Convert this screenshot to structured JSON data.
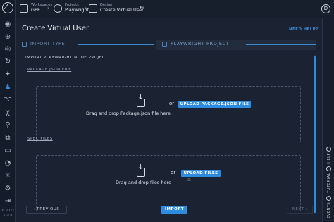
{
  "topbar": {
    "workspace_small": "Workspaces",
    "workspace_name": "GPE",
    "projects_small": "Projects",
    "project_name": "Playwright",
    "design_small": "Design",
    "design_name": "Create Virtual User",
    "back_icon": "arrow-left-icon",
    "avatar_letter": "D"
  },
  "page": {
    "title": "Create Virtual User",
    "help_link": "NEED HELP?"
  },
  "steps": [
    {
      "label": "IMPORT TYPE",
      "state": "done"
    },
    {
      "label": "PLAYWRIGHT PROJECT",
      "state": "current"
    }
  ],
  "import": {
    "section_title": "IMPORT PLAYWRIGHT NODE PROJECT",
    "package_label": "PACKAGE.JSON FILE",
    "package_drop_text": "Drag and drop Package.json file here",
    "package_or": "or",
    "package_button": "UPLOAD PACKAGE.JSON FILE",
    "spec_label": "SPEC FILES",
    "spec_drop_text": "Drag and drop files here",
    "spec_or": "or",
    "spec_button": "UPLOAD FILES"
  },
  "footer": {
    "previous": "PREVIOUS",
    "import": "IMPORT",
    "next": "NEXT"
  },
  "sidebar": {
    "copyright": "© 2023",
    "version": "v14.0",
    "icons": [
      "dashboard-icon",
      "globe-icon",
      "recorder-icon",
      "sync-icon",
      "design-icon",
      "users-icon",
      "graph-icon",
      "formula-icon",
      "plug-icon",
      "network-icon",
      "terminal-icon",
      "gauge-icon",
      "bug-icon",
      "chat-icon",
      "settings-icon",
      "collapse-icon"
    ]
  },
  "rail": {
    "help": "HELP",
    "tutorial": "TUTORIAL",
    "events": "EVENTS"
  },
  "colors": {
    "accent": "#2d8ce0",
    "background": "#1b2333",
    "sidebar": "#151c29"
  }
}
